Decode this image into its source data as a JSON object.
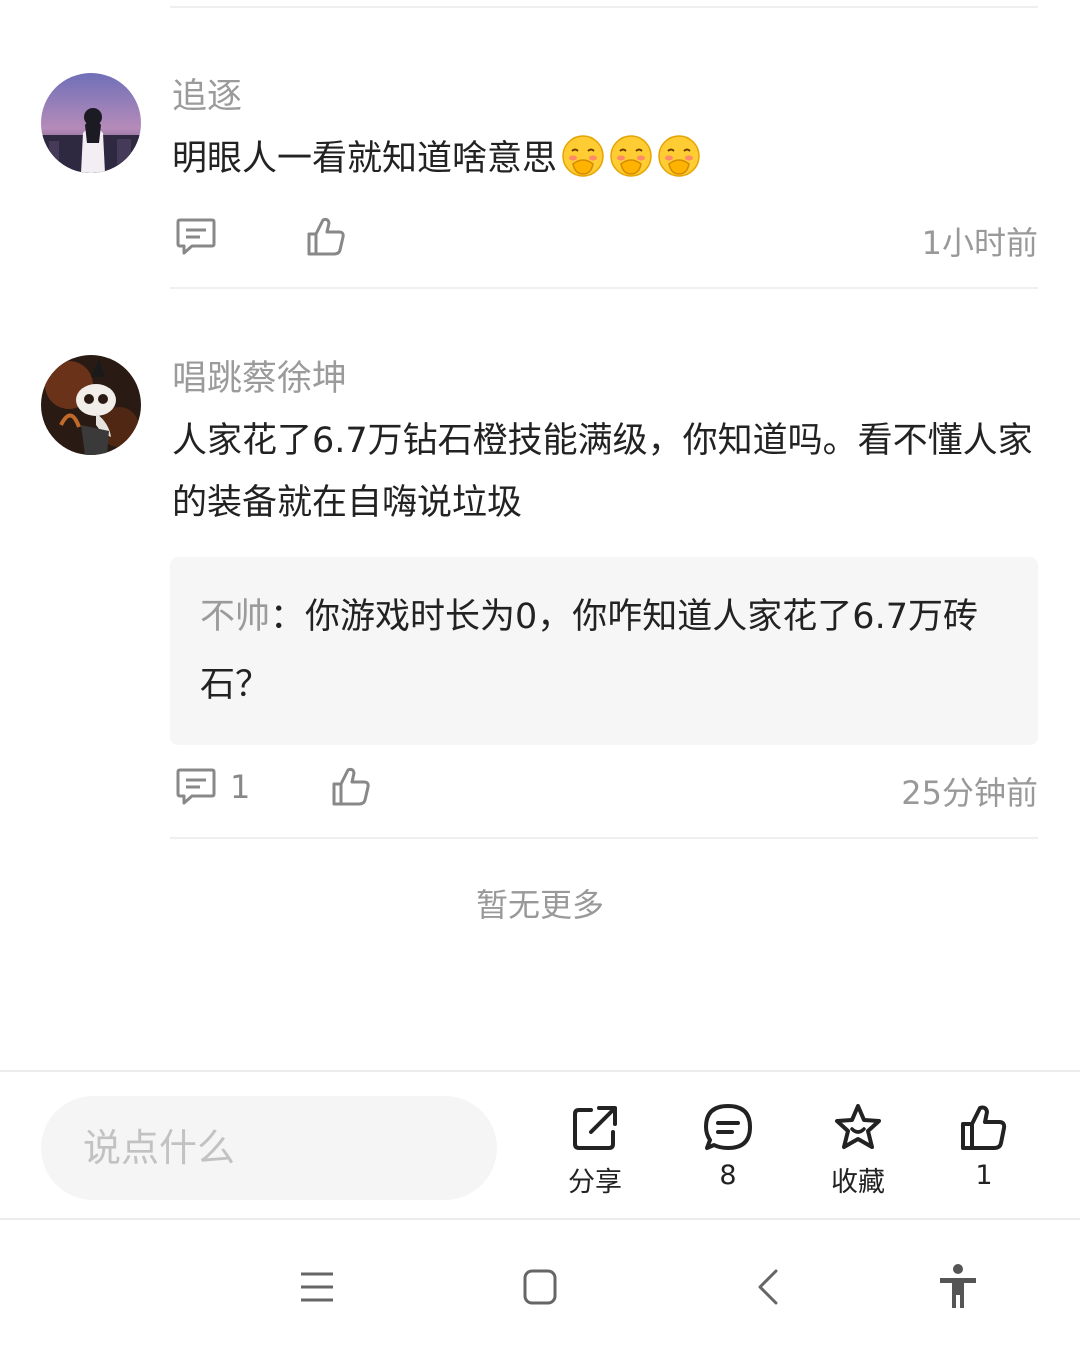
{
  "comments": [
    {
      "username": "追逐",
      "text": "明眼人一看就知道啥意思",
      "emojis": [
        "face-with-hand-over-mouth",
        "face-with-hand-over-mouth",
        "face-with-hand-over-mouth"
      ],
      "time": "1小时前"
    },
    {
      "username": "唱跳蔡徐坤",
      "text": "人家花了6.7万钻石橙技能满级，你知道吗。看不懂人家的装备就在自嗨说垃圾",
      "reply": {
        "author": "不帅",
        "separator": "：",
        "text": "你游戏时长为0，你咋知道人家花了6.7万砖石？"
      },
      "reply_count": "1",
      "time": "25分钟前"
    }
  ],
  "no_more": "暂无更多",
  "bottom_bar": {
    "input_placeholder": "说点什么",
    "share_label": "分享",
    "comment_count": "8",
    "favorite_label": "收藏",
    "like_count": "1"
  }
}
